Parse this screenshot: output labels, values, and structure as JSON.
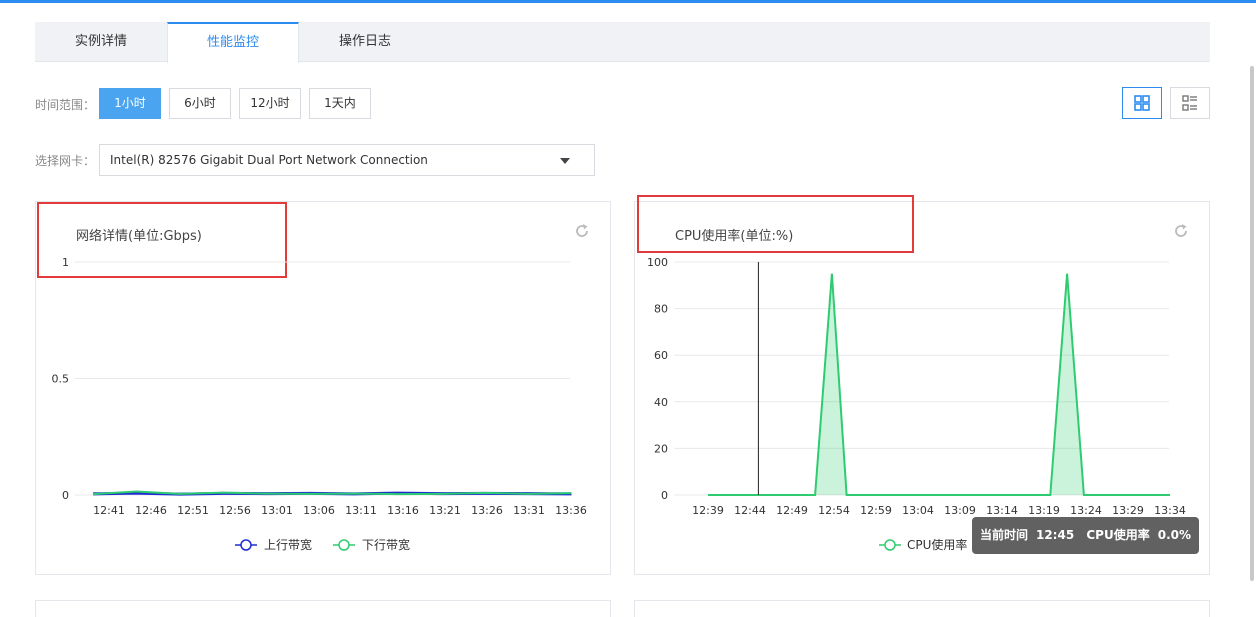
{
  "tabs": [
    {
      "label": "实例详情",
      "active": false
    },
    {
      "label": "性能监控",
      "active": true
    },
    {
      "label": "操作日志",
      "active": false
    }
  ],
  "time_range": {
    "label": "时间范围：",
    "options": [
      "1小时",
      "6小时",
      "12小时",
      "1天内"
    ],
    "selected": "1小时"
  },
  "nic": {
    "label": "选择网卡：",
    "selected": "Intel(R) 82576 Gigabit Dual Port Network Connection"
  },
  "view_toggle": {
    "grid_icon": "grid-view-icon",
    "list_icon": "list-view-icon",
    "active": "grid"
  },
  "colors": {
    "accent": "#2d8cf0",
    "upload": "#1f2bd1",
    "download": "#2ecc71",
    "cpu": "#2ecc71",
    "highlight": "#e33b3b"
  },
  "network_panel": {
    "title": "网络详情(单位:Gbps)",
    "refresh_icon": "refresh-icon",
    "chart_data": {
      "type": "line",
      "title": "网络详情(单位:Gbps)",
      "x": [
        "12:41",
        "12:46",
        "12:51",
        "12:56",
        "13:01",
        "13:06",
        "13:11",
        "13:16",
        "13:21",
        "13:26",
        "13:31",
        "13:36"
      ],
      "ylim": [
        0,
        1
      ],
      "yticks": [
        "0",
        "0.5",
        "1"
      ],
      "series": [
        {
          "name": "上行带宽",
          "values": [
            0.005,
            0.008,
            0.004,
            0.007,
            0.006,
            0.007,
            0.005,
            0.008,
            0.006,
            0.007,
            0.006,
            0.005
          ]
        },
        {
          "name": "下行带宽",
          "values": [
            0.004,
            0.015,
            0.005,
            0.01,
            0.006,
            0.005,
            0.006,
            0.004,
            0.005,
            0.009,
            0.005,
            0.008
          ]
        }
      ],
      "legend": "bottom",
      "grid": true
    }
  },
  "cpu_panel": {
    "title": "CPU使用率(单位:%)",
    "refresh_icon": "refresh-icon",
    "chart_data": {
      "type": "area",
      "title": "CPU使用率(单位:%)",
      "x": [
        "12:39",
        "12:44",
        "12:49",
        "12:54",
        "12:59",
        "13:04",
        "13:09",
        "13:14",
        "13:19",
        "13:24",
        "13:29",
        "13:34"
      ],
      "ylim": [
        0,
        100
      ],
      "yticks": [
        "0",
        "20",
        "40",
        "60",
        "80",
        "100"
      ],
      "series": [
        {
          "name": "CPU使用率",
          "points": [
            [
              0,
              0
            ],
            [
              2.55,
              0
            ],
            [
              2.95,
              95
            ],
            [
              3.3,
              0
            ],
            [
              8.15,
              0
            ],
            [
              8.55,
              95
            ],
            [
              8.95,
              0
            ],
            [
              11,
              0
            ]
          ]
        }
      ],
      "cursor_x": 1.2,
      "legend": "bottom",
      "grid": true
    },
    "tooltip": {
      "time_label": "当前时间",
      "time": "12:45",
      "metric": "CPU使用率",
      "value": "0.0%"
    }
  }
}
